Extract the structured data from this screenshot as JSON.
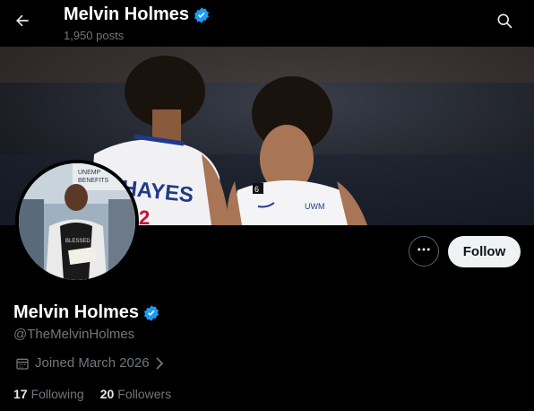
{
  "header": {
    "name": "Melvin Holmes",
    "posts_count": "1,950 posts",
    "back_icon": "arrow-left-icon",
    "search_icon": "search-icon"
  },
  "banner": {
    "jersey_left_text": "HAYES",
    "jersey_right_number": "2",
    "jersey_right_badge": "6",
    "jersey_right_sponsor": "UWM",
    "jersey_left_number": "2"
  },
  "avatar": {
    "sign_text_1": "UNEMP",
    "sign_text_2": "BENEFITS",
    "hoodie_text": "BLESSED"
  },
  "profile": {
    "display_name": "Melvin Holmes",
    "handle": "@TheMelvinHolmes",
    "joined": "Joined March 2026",
    "following_count": "17",
    "following_label": "Following",
    "followers_count": "20",
    "followers_label": "Followers"
  },
  "actions": {
    "more_icon": "more-horizontal-icon",
    "follow_label": "Follow"
  },
  "colors": {
    "background": "#000000",
    "verified": "#1d9bf0",
    "muted_text": "#71767b",
    "follow_bg": "#eff3f4"
  }
}
